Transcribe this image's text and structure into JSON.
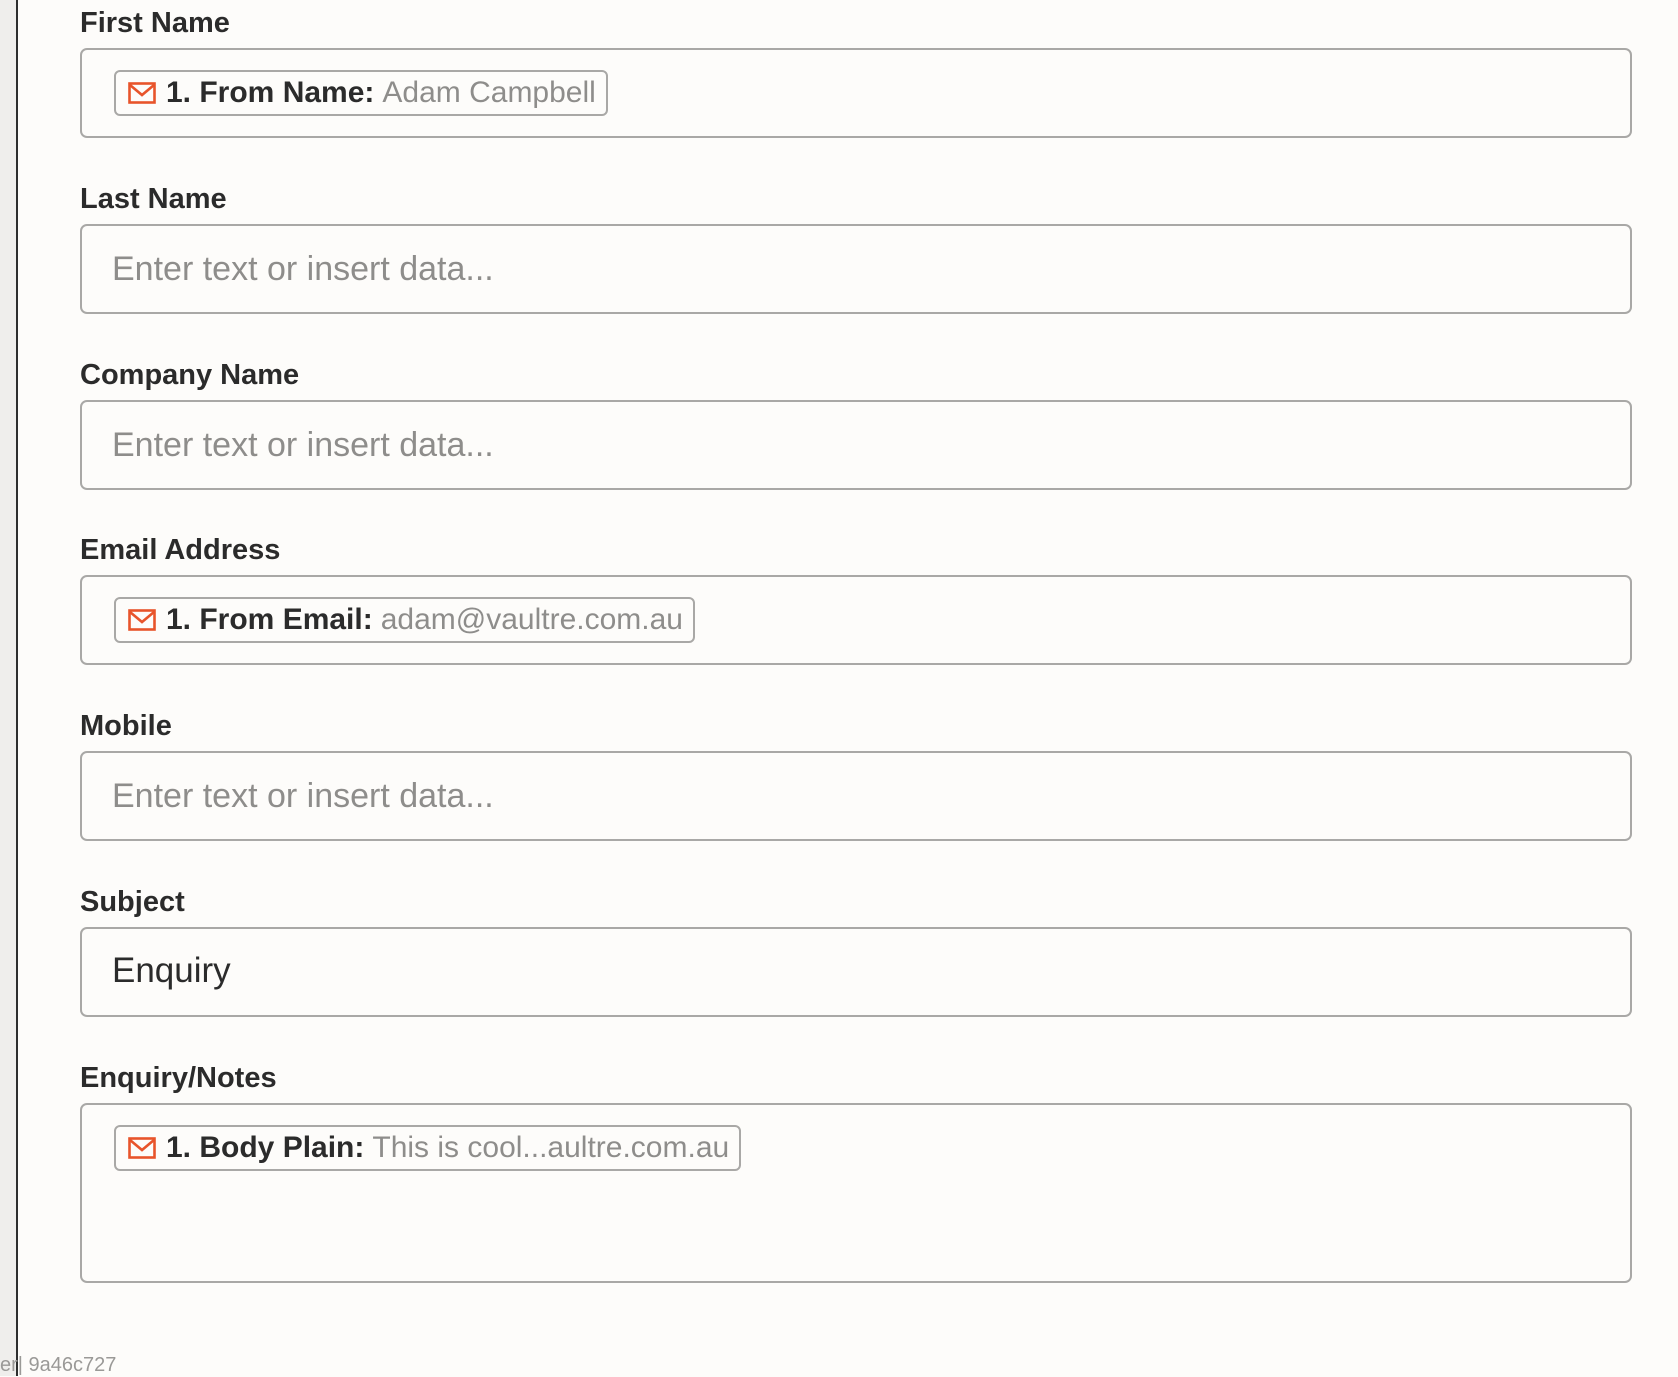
{
  "fields": [
    {
      "label": "First Name",
      "pill": {
        "key": "1. From Name:",
        "value": "Adam Campbell",
        "icon": "mail-icon"
      }
    },
    {
      "label": "Last Name",
      "placeholder": "Enter text or insert data..."
    },
    {
      "label": "Company Name",
      "placeholder": "Enter text or insert data..."
    },
    {
      "label": "Email Address",
      "pill": {
        "key": "1. From Email:",
        "value": "adam@vaultre.com.au",
        "icon": "mail-icon"
      }
    },
    {
      "label": "Mobile",
      "placeholder": "Enter text or insert data..."
    },
    {
      "label": "Subject",
      "value": "Enquiry"
    },
    {
      "label": "Enquiry/Notes",
      "pill": {
        "key": "1. Body Plain:",
        "value": "This is cool...aultre.com.au",
        "icon": "mail-icon"
      }
    }
  ],
  "footer": {
    "version_text": "er| 9a46c727"
  },
  "colors": {
    "accent_icon": "#e8542b",
    "background": "#fdfcfa",
    "border": "#a9a8a6"
  }
}
